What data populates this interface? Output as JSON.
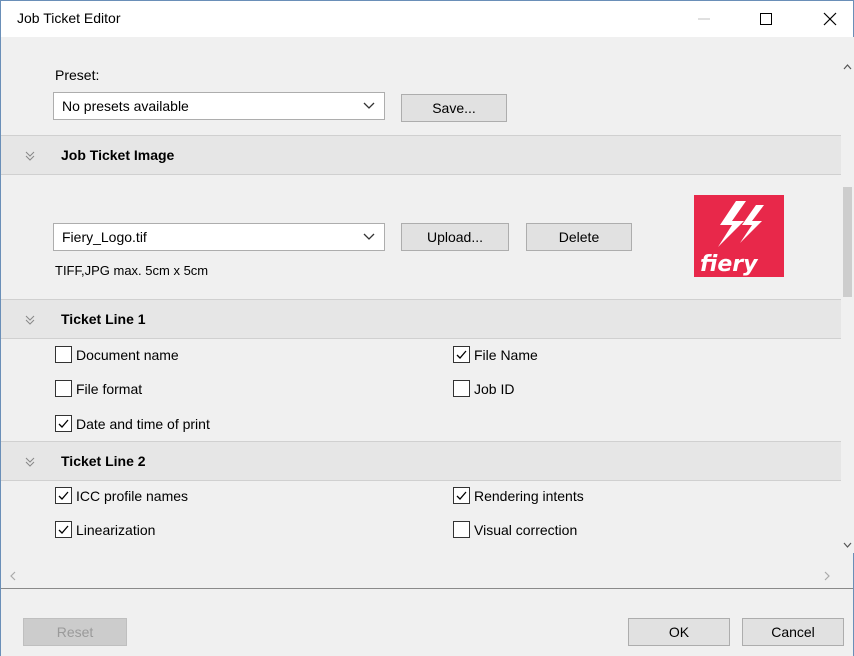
{
  "window": {
    "title": "Job Ticket Editor"
  },
  "preset": {
    "label": "Preset:",
    "selected": "No presets available",
    "save_label": "Save..."
  },
  "image_section": {
    "title": "Job Ticket Image",
    "selected_file": "Fiery_Logo.tif",
    "upload_label": "Upload...",
    "delete_label": "Delete",
    "hint": "TIFF,JPG  max. 5cm x 5cm",
    "logo_text": "fiery",
    "brand_color": "#e8284a"
  },
  "ticket_line_1": {
    "title": "Ticket Line 1",
    "options": [
      {
        "label": "Document name",
        "checked": false
      },
      {
        "label": "File Name",
        "checked": true
      },
      {
        "label": "File format",
        "checked": false
      },
      {
        "label": "Job ID",
        "checked": false
      },
      {
        "label": "Date and time of print",
        "checked": true
      }
    ]
  },
  "ticket_line_2": {
    "title": "Ticket Line 2",
    "options": [
      {
        "label": "ICC profile names",
        "checked": true
      },
      {
        "label": "Rendering intents",
        "checked": true
      },
      {
        "label": "Linearization",
        "checked": true
      },
      {
        "label": "Visual correction",
        "checked": false
      }
    ]
  },
  "footer": {
    "reset_label": "Reset",
    "ok_label": "OK",
    "cancel_label": "Cancel"
  }
}
